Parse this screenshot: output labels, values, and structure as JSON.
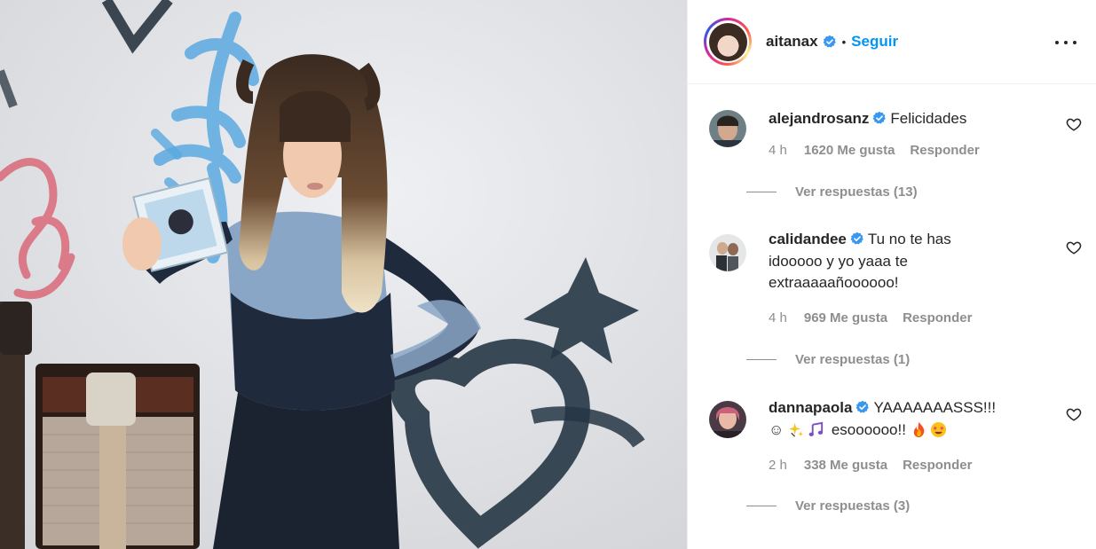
{
  "post": {
    "username": "aitanax",
    "separator": "•",
    "follow_label": "Seguir",
    "more_icon": "more-horizontal-icon",
    "verified_color": "#3897f0",
    "accent_color": "#0095f6"
  },
  "comments": [
    {
      "username": "alejandrosanz",
      "text": "Felicidades",
      "time": "4 h",
      "likes": "1620 Me gusta",
      "reply": "Responder",
      "view_replies": "Ver respuestas (13)"
    },
    {
      "username": "calidandee",
      "text": "Tu no te has idooooo y yo yaaa te extraaaaañoooooo!",
      "time": "4 h",
      "likes": "969 Me gusta",
      "reply": "Responder",
      "view_replies": "Ver respuestas (1)"
    },
    {
      "username": "dannapaola",
      "text": "YAAAAAAASSS!!!",
      "text2_prefix": "☺",
      "text2_mid": "esoooooo!!",
      "emojis": [
        "smiling-face-icon",
        "sparkles-icon",
        "music-notes-icon",
        "fire-icon",
        "star-struck-icon"
      ],
      "time": "2 h",
      "likes": "338 Me gusta",
      "reply": "Responder",
      "view_replies": "Ver respuestas (3)"
    }
  ]
}
